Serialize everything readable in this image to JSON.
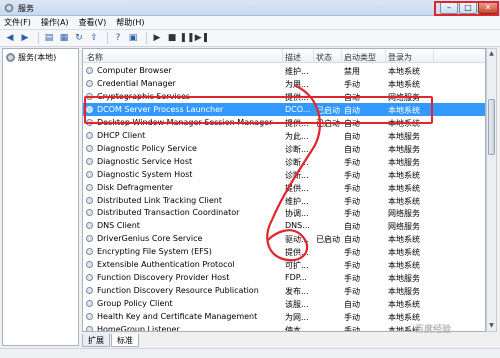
{
  "window": {
    "title": "服务"
  },
  "menu": [
    "文件(F)",
    "操作(A)",
    "查看(V)",
    "帮助(H)"
  ],
  "tree": {
    "root_label": "服务(本地)"
  },
  "columns": {
    "name": "名称",
    "desc": "描述",
    "status": "状态",
    "startup": "启动类型",
    "logon": "登录为"
  },
  "services": [
    {
      "name": "Computer Browser",
      "desc": "维护...",
      "status": "",
      "startup": "禁用",
      "logon": "本地系统"
    },
    {
      "name": "Credential Manager",
      "desc": "为用...",
      "status": "",
      "startup": "手动",
      "logon": "本地系统"
    },
    {
      "name": "Cryptographic Services",
      "desc": "提供...",
      "status": "",
      "startup": "自动",
      "logon": "网络服务"
    },
    {
      "name": "DCOM Server Process Launcher",
      "desc": "DCO...",
      "status": "已启动",
      "startup": "自动",
      "logon": "本地系统"
    },
    {
      "name": "Desktop Window Manager Session Manager",
      "desc": "提供...",
      "status": "已启动",
      "startup": "自动",
      "logon": "本地系统"
    },
    {
      "name": "DHCP Client",
      "desc": "为此...",
      "status": "",
      "startup": "自动",
      "logon": "本地服务"
    },
    {
      "name": "Diagnostic Policy Service",
      "desc": "诊断...",
      "status": "",
      "startup": "自动",
      "logon": "本地服务"
    },
    {
      "name": "Diagnostic Service Host",
      "desc": "诊断...",
      "status": "",
      "startup": "手动",
      "logon": "本地服务"
    },
    {
      "name": "Diagnostic System Host",
      "desc": "诊断...",
      "status": "",
      "startup": "手动",
      "logon": "本地系统"
    },
    {
      "name": "Disk Defragmenter",
      "desc": "提供...",
      "status": "",
      "startup": "手动",
      "logon": "本地系统"
    },
    {
      "name": "Distributed Link Tracking Client",
      "desc": "维护...",
      "status": "",
      "startup": "手动",
      "logon": "本地系统"
    },
    {
      "name": "Distributed Transaction Coordinator",
      "desc": "协调...",
      "status": "",
      "startup": "手动",
      "logon": "网络服务"
    },
    {
      "name": "DNS Client",
      "desc": "DNS...",
      "status": "",
      "startup": "自动",
      "logon": "网络服务"
    },
    {
      "name": "DriverGenius Core Service",
      "desc": "驱动...",
      "status": "已启动",
      "startup": "自动",
      "logon": "本地系统"
    },
    {
      "name": "Encrypting File System (EFS)",
      "desc": "提供...",
      "status": "",
      "startup": "手动",
      "logon": "本地系统"
    },
    {
      "name": "Extensible Authentication Protocol",
      "desc": "可扩...",
      "status": "",
      "startup": "手动",
      "logon": "本地系统"
    },
    {
      "name": "Function Discovery Provider Host",
      "desc": "FDP...",
      "status": "",
      "startup": "手动",
      "logon": "本地服务"
    },
    {
      "name": "Function Discovery Resource Publication",
      "desc": "发布...",
      "status": "",
      "startup": "手动",
      "logon": "本地服务"
    },
    {
      "name": "Group Policy Client",
      "desc": "该服...",
      "status": "",
      "startup": "自动",
      "logon": "本地系统"
    },
    {
      "name": "Health Key and Certificate Management",
      "desc": "为网...",
      "status": "",
      "startup": "手动",
      "logon": "本地系统"
    },
    {
      "name": "HomeGroup Listener",
      "desc": "使本...",
      "status": "",
      "startup": "手动",
      "logon": "本地系统"
    }
  ],
  "selected_index": 3,
  "tabs": [
    "扩展",
    "标准"
  ],
  "watermark": "百度经验",
  "colors": {
    "selection": "#3399ff",
    "annotation": "#e0262d"
  },
  "icons": [
    "back-icon",
    "forward-icon",
    "show-tree-icon",
    "properties-icon",
    "refresh-icon",
    "export-icon",
    "help-icon",
    "play-icon",
    "stop-icon",
    "pause-icon",
    "restart-icon"
  ]
}
